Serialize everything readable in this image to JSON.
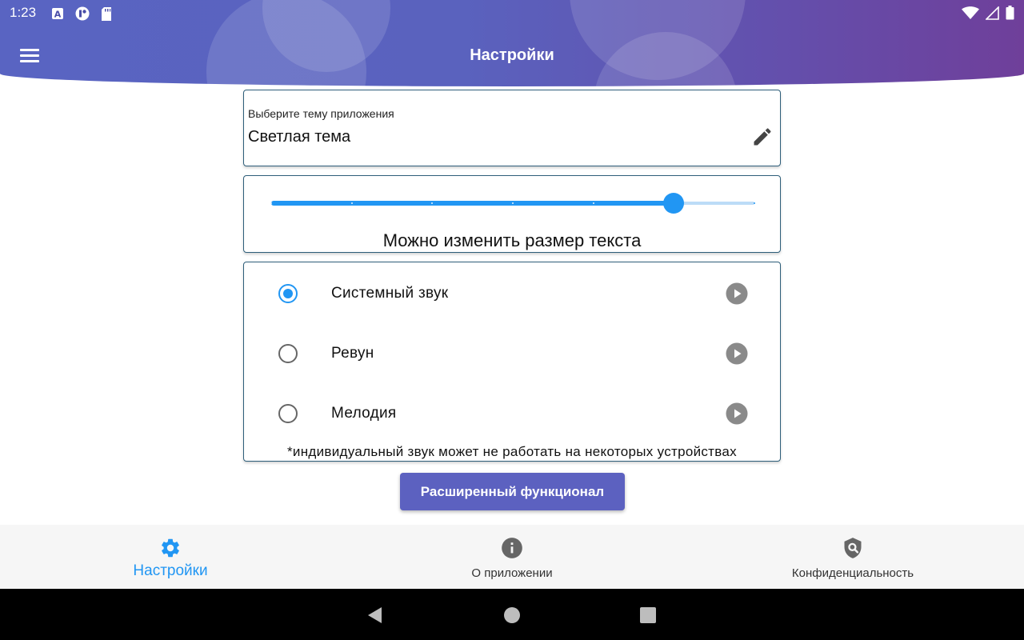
{
  "status_bar": {
    "time": "1:23",
    "icons_left": [
      "accessibility-a-icon",
      "notification-app-icon",
      "sd-card-icon"
    ],
    "icons_right": [
      "wifi-icon",
      "signal-icon",
      "battery-icon"
    ]
  },
  "app_bar": {
    "title": "Настройки",
    "menu_icon": "hamburger-menu-icon",
    "gradient": [
      "#5964c2",
      "#6f3f9a"
    ]
  },
  "theme": {
    "label": "Выберите тему приложения",
    "value": "Светлая тема",
    "edit_icon": "pencil-icon"
  },
  "text_size": {
    "caption": "Можно изменить размер текста",
    "slider_steps": 6,
    "slider_value_index": 5,
    "accent": "#2196f3"
  },
  "sounds": {
    "options": [
      {
        "label": "Системный звук",
        "selected": true
      },
      {
        "label": "Ревун",
        "selected": false
      },
      {
        "label": "Мелодия",
        "selected": false
      }
    ],
    "note": "*индивидуальный звук может не работать на некоторых устройствах",
    "play_icon": "play-circle-icon"
  },
  "advanced_button": {
    "label": "Расширенный функционал",
    "color": "#5c61c0"
  },
  "bottom_nav": {
    "items": [
      {
        "label": "Настройки",
        "icon": "gear-icon",
        "active": true
      },
      {
        "label": "О приложении",
        "icon": "info-icon",
        "active": false
      },
      {
        "label": "Конфиденциальность",
        "icon": "shield-search-icon",
        "active": false
      }
    ],
    "active_color": "#2196f3"
  },
  "system_nav": {
    "icons": [
      "back-triangle-icon",
      "home-circle-icon",
      "recents-square-icon"
    ]
  }
}
